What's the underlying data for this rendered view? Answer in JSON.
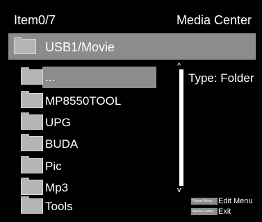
{
  "header": {
    "item_count": "Item0/7",
    "title": "Media Center"
  },
  "path": {
    "label": "USB1/Movie"
  },
  "files": [
    {
      "name": "...",
      "selected": true
    },
    {
      "name": "MP8550TOOL"
    },
    {
      "name": "UPG"
    },
    {
      "name": "BUDA"
    },
    {
      "name": "Pic"
    },
    {
      "name": "Mp3"
    },
    {
      "name": "Tools"
    }
  ],
  "info": {
    "type": "Type: Folder"
  },
  "scroll": {
    "up": "^",
    "down": "v"
  },
  "hints": [
    {
      "key": "Popup Menu",
      "action": "Edit Menu"
    },
    {
      "key": "Media Center",
      "action": "Exit"
    }
  ],
  "colors": {
    "background": "#000000",
    "highlight": "#8c8c8c",
    "folder": "#b5b5b5"
  }
}
